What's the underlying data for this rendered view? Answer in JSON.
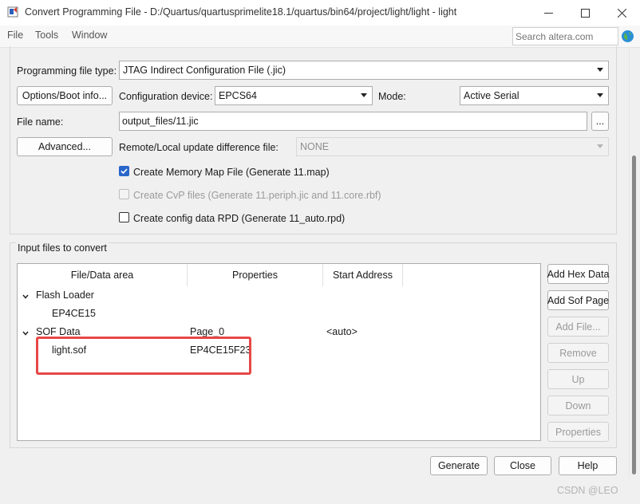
{
  "window": {
    "title": "Convert Programming File - D:/Quartus/quartusprimelite18.1/quartus/bin64/project/light/light - light"
  },
  "menu": [
    "File",
    "Tools",
    "Window"
  ],
  "search": {
    "placeholder": "Search altera.com"
  },
  "output": {
    "programming_file_type_label": "Programming file type:",
    "programming_file_type_value": "JTAG Indirect Configuration File (.jic)",
    "options_button": "Options/Boot info...",
    "config_device_label": "Configuration device:",
    "config_device_value": "EPCS64",
    "mode_label": "Mode:",
    "mode_value": "Active Serial",
    "file_name_label": "File name:",
    "file_name_value": "output_files/11.jic",
    "browse_button": "...",
    "advanced_button": "Advanced...",
    "remote_label": "Remote/Local update difference file:",
    "remote_value": "NONE",
    "chk_memory_map": "Create Memory Map File (Generate 11.map)",
    "chk_cvp": "Create CvP files (Generate 11.periph.jic and 11.core.rbf)",
    "chk_rpd": "Create config data RPD (Generate 11_auto.rpd)"
  },
  "input": {
    "group_title": "Input files to convert",
    "columns": [
      "File/Data area",
      "Properties",
      "Start Address"
    ],
    "flash_loader": "Flash Loader",
    "flash_device": "EP4CE15",
    "sof_data": "SOF Data",
    "sof_page": "Page_0",
    "sof_address": "<auto>",
    "sof_file": "light.sof",
    "sof_file_device": "EP4CE15F23"
  },
  "side_buttons": {
    "add_hex": "Add Hex Data",
    "add_sof": "Add Sof Page",
    "add_file": "Add File...",
    "remove": "Remove",
    "up": "Up",
    "down": "Down",
    "properties": "Properties"
  },
  "footer": {
    "generate": "Generate",
    "close": "Close",
    "help": "Help"
  },
  "watermark": "CSDN @LEO"
}
